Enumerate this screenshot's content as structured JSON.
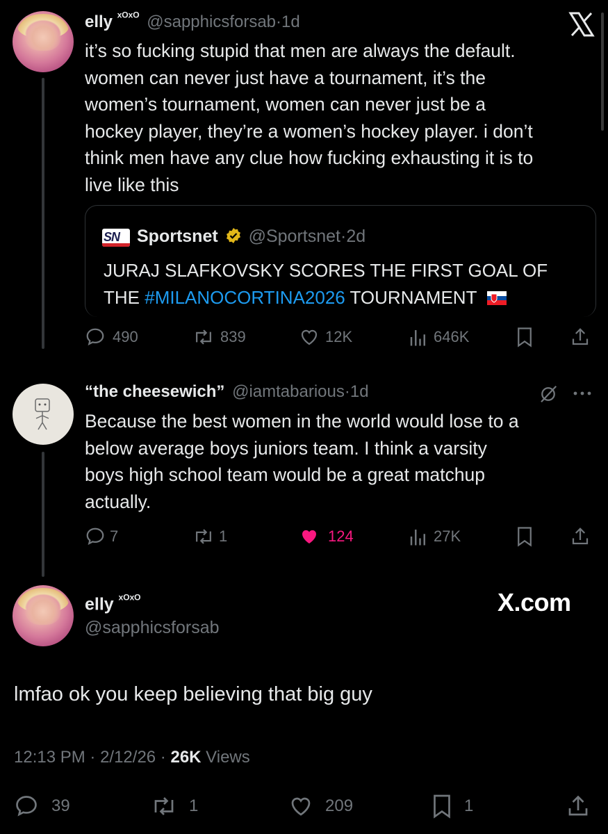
{
  "tweet1": {
    "name": "elly",
    "badge": "ˣᴼˣᴼ",
    "handle": "@sapphicsforsab",
    "time": "1d",
    "lines": [
      "it’s so fucking stupid that men are always the default.",
      "women can never just have a tournament, it’s the",
      "women’s tournament, women can never just be a",
      "hockey player, they’re a women’s hockey player. i don’t",
      "think men have any clue how fucking exhausting it is to",
      "live like this"
    ],
    "quote": {
      "logo_text": "SN",
      "name": "Sportsnet",
      "handle": "@Sportsnet",
      "time": "2d",
      "line1": "JURAJ SLAFKOVSKY SCORES THE FIRST GOAL OF",
      "line2_prefix": "THE ",
      "hashtag": "#MILANOCORTINA2026",
      "line2_suffix": " TOURNAMENT"
    },
    "stats": {
      "replies": "490",
      "reposts": "839",
      "likes": "12K",
      "views": "646K"
    }
  },
  "tweet2": {
    "name": "“the cheesewich”",
    "handle": "@iamtabarious",
    "time": "1d",
    "lines": [
      "Because the best women in the world would lose to a",
      "below average boys juniors team. I think a varsity",
      "boys high school team would be a great matchup",
      "actually."
    ],
    "stats": {
      "replies": "7",
      "reposts": "1",
      "likes": "124",
      "views": "27K"
    }
  },
  "tweet3": {
    "name": "elly",
    "badge": "ˣᴼˣᴼ",
    "handle": "@sapphicsforsab",
    "watermark": "X.com",
    "text": "lmfao ok you keep believing that big guy",
    "time": "12:13 PM",
    "date": "2/12/26",
    "views_count": "26K",
    "views_label": "Views",
    "stats": {
      "replies": "39",
      "reposts": "1",
      "likes": "209",
      "bookmarks": "1"
    }
  },
  "colors": {
    "background": "#000000",
    "text": "#e7e9ea",
    "muted": "#71767b",
    "link": "#1d9bf0",
    "like": "#f91880",
    "verified": "#e2b719",
    "sportsnet_red": "#d2232a"
  },
  "icons": [
    "x-logo-icon",
    "verified-badge-icon",
    "slovakia-flag-icon",
    "reply-icon",
    "repost-icon",
    "like-icon",
    "views-icon",
    "bookmark-icon",
    "share-icon",
    "grok-icon",
    "more-icon"
  ]
}
